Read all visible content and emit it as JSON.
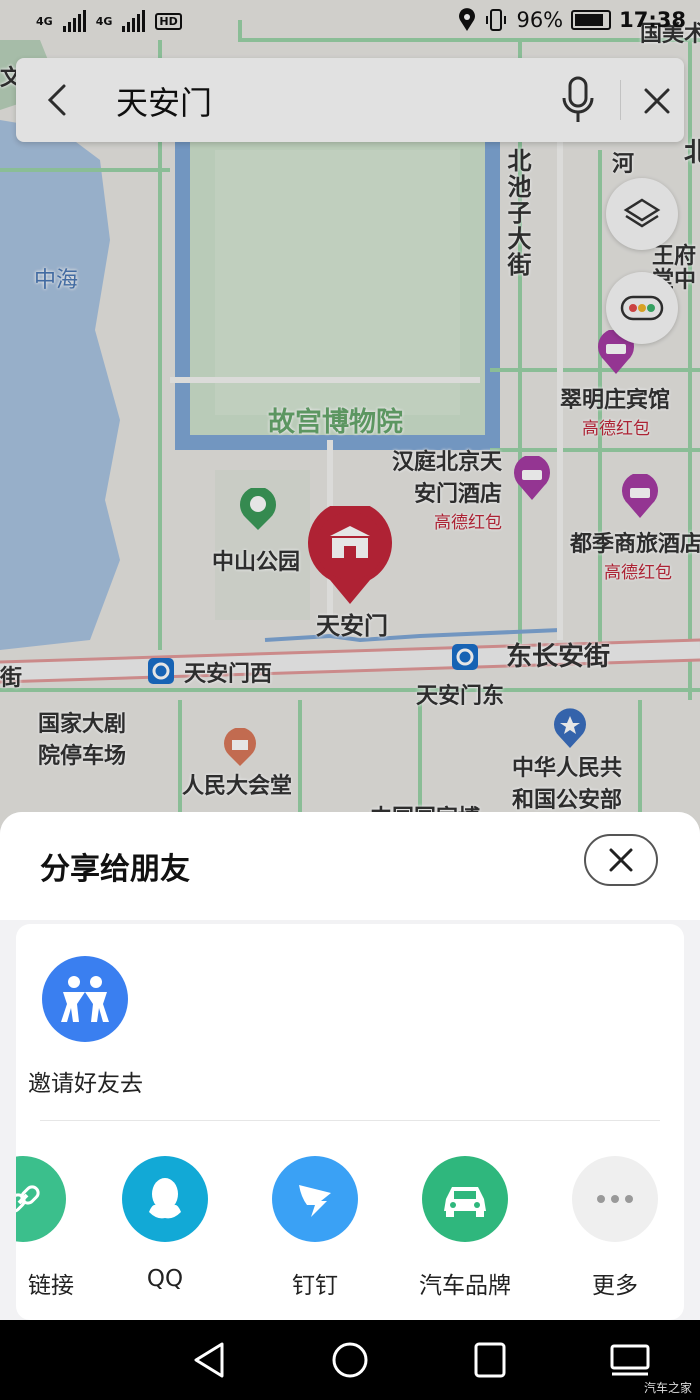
{
  "status_bar": {
    "signal1": "4G",
    "signal2": "4G",
    "hd_badge": "HD",
    "battery_pct": "96%",
    "time": "17:38"
  },
  "search": {
    "query": "天安门"
  },
  "map": {
    "labels": {
      "zhonghai": "中海",
      "palace_museum": "故宫博物院",
      "beichizi": "北池子大街",
      "cuiming": "翠明庄宾馆",
      "cuiming_sub": "高德红包",
      "hanting": "汉庭北京天",
      "hanting2": "安门酒店",
      "hanting_sub": "高德红包",
      "dujis": "都季商旅酒店",
      "dujis_sub": "高德红包",
      "zhongshan_park": "中山公园",
      "tiananmen": "天安门",
      "tiananmen_west": "天安门西",
      "tiananmen_east": "天安门东",
      "dongchangan": "东长安街",
      "street_left": "街",
      "theatre1": "国家大剧",
      "theatre2": "院停车场",
      "great_hall": "人民大会堂",
      "mps1": "中华人民共",
      "mps2": "和国公安部",
      "partial_bottom": "中国国家博",
      "partial_top_right": "国美术",
      "partial_right": "北",
      "partial_right2": "河",
      "partial_right3": "王府",
      "partial_right4": "堂中",
      "partial_left": "文"
    },
    "colors": {
      "water": "#a9c3e0",
      "water_edge": "#7fa7d6",
      "park": "#cfe3cd",
      "road_green": "#9ad3a8",
      "road_red": "#e29a9a",
      "pin_red": "#c3263a",
      "hotel_purple": "#a53ba3"
    }
  },
  "share_sheet": {
    "title": "分享给朋友",
    "invite_label": "邀请好友去",
    "items": [
      {
        "label": "链接",
        "icon": "link-icon",
        "color": "#3bbf8c"
      },
      {
        "label": "QQ",
        "icon": "qq-icon",
        "color": "#12a9d6"
      },
      {
        "label": "钉钉",
        "icon": "dingtalk-icon",
        "color": "#3aa1f5"
      },
      {
        "label": "汽车品牌",
        "icon": "car-icon",
        "color": "#2fb77d"
      },
      {
        "label": "更多",
        "icon": "more-icon",
        "color": "#efefef"
      }
    ]
  },
  "watermark": "汽车之家"
}
